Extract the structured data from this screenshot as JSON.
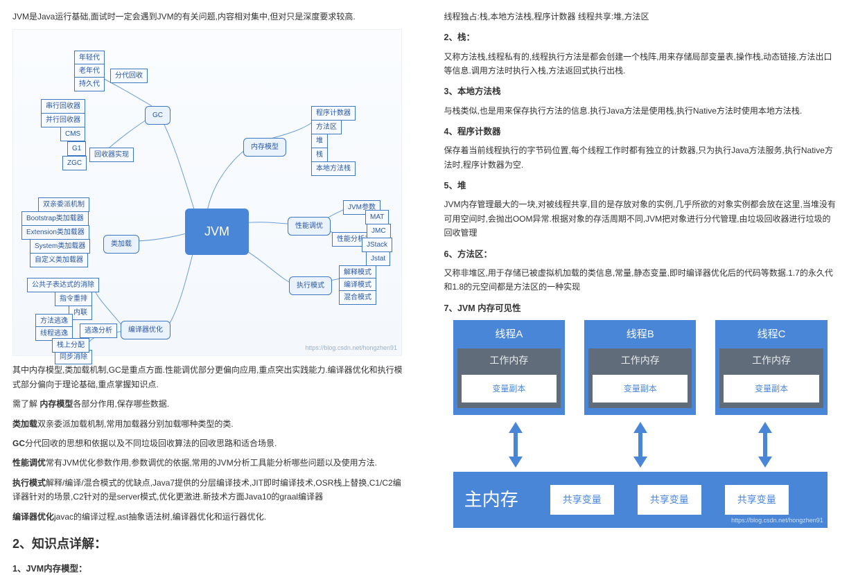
{
  "left": {
    "intro": "JVM是Java运行基础,面试时一定会遇到JVM的有关问题,内容相对集中,但对只是深度要求较高.",
    "mindmap": {
      "center": "JVM",
      "gc": {
        "label": "GC",
        "split": "分代回收",
        "gens": [
          "年轻代",
          "老年代",
          "持久代"
        ],
        "impl_label": "回收器实现",
        "impls": [
          "串行回收器",
          "并行回收器",
          "CMS",
          "G1",
          "ZGC"
        ]
      },
      "mem": {
        "label": "内存模型",
        "items": [
          "程序计数器",
          "方法区",
          "堆",
          "栈",
          "本地方法栈"
        ]
      },
      "perf": {
        "label": "性能调优",
        "jvm_args": "JVM参数",
        "tools_label": "性能分析工具",
        "tools": [
          "MAT",
          "JMC",
          "JStack",
          "Jstat"
        ]
      },
      "load": {
        "label": "类加载",
        "items": [
          "双亲委派机制",
          "Bootstrap类加载器",
          "Extension类加载器",
          "System类加载器",
          "自定义类加载器"
        ]
      },
      "exec": {
        "label": "执行模式",
        "items": [
          "解释模式",
          "编译模式",
          "混合模式"
        ]
      },
      "opt": {
        "label": "编译器优化",
        "items": [
          "公共子表达式的消除",
          "指令重排",
          "内联",
          "同步消除"
        ],
        "escape_label": "逃逸分析",
        "escape": [
          "方法逃逸",
          "线程逃逸",
          "栈上分配"
        ]
      },
      "watermark": "https://blog.csdn.net/hongzhen91"
    },
    "para1": "其中内存模型,类加载机制,GC是重点方面.性能调优部分更偏向应用,重点突出实践能力.编译器优化和执行模式部分偏向于理论基础,重点掌握知识点.",
    "line_mem_label": "内存模型",
    "line_mem": "需了解 ",
    "line_mem_tail": "各部分作用,保存哪些数据.",
    "line_load_label": "类加载",
    "line_load": "双亲委派加载机制,常用加载器分别加载哪种类型的类.",
    "line_gc_label": "GC",
    "line_gc": "分代回收的思想和依据以及不同垃圾回收算法的回收思路和适合场景.",
    "line_perf_label": "性能调优",
    "line_perf": "常有JVM优化参数作用,参数调优的依据,常用的JVM分析工具能分析哪些问题以及使用方法.",
    "line_exec_label": "执行模式",
    "line_exec": "解释/编译/混合模式的优缺点,Java7提供的分层编译技术,JIT即时编译技术,OSR栈上替换,C1/C2编译器针对的场景,C2针对的是server模式,优化更激进.新技术方面Java10的graal编译器",
    "line_opt_label": "编译器优化",
    "line_opt": "javac的编译过程,ast抽象语法树,编译器优化和运行器优化.",
    "h2": "2、知识点详解：",
    "h3_1": "1、JVM内存模型："
  },
  "right": {
    "share": "线程独占:栈,本地方法栈,程序计数器 线程共享:堆,方法区",
    "s2_t": "2、栈：",
    "s2": "又称方法栈,线程私有的,线程执行方法是都会创建一个栈阵,用来存储局部变量表,操作栈,动态链接,方法出口等信息.调用方法时执行入栈,方法返回式执行出栈.",
    "s3_t": "3、本地方法栈",
    "s3": "与栈类似,也是用来保存执行方法的信息.执行Java方法是使用栈,执行Native方法时使用本地方法栈.",
    "s4_t": "4、程序计数器",
    "s4": "保存着当前线程执行的字节码位置,每个线程工作时都有独立的计数器,只为执行Java方法服务,执行Native方法时,程序计数器为空.",
    "s5_t": "5、堆",
    "s5": "JVM内存管理最大的一块,对被线程共享,目的是存放对象的实例,几乎所欲的对象实例都会放在这里,当堆没有可用空间时,会抛出OOM异常.根据对象的存活周期不同,JVM把对象进行分代管理,由垃圾回收器进行垃圾的回收管理",
    "s6_t": "6、方法区：",
    "s6": "又称非堆区,用于存储已被虚拟机加载的类信息,常量,静态变量,即时编译器优化后的代码等数据.1.7的永久代和1.8的元空间都是方法区的一种实现",
    "s7_t": "7、JVM 内存可见性",
    "mv": {
      "threads": [
        "线程A",
        "线程B",
        "线程C"
      ],
      "workmem": "工作内存",
      "varcopy": "变量副本",
      "mainmem": "主内存",
      "shared": "共享变量",
      "watermark": "https://blog.csdn.net/hongzhen91"
    }
  }
}
